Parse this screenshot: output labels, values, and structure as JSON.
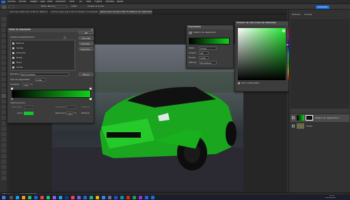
{
  "app": {
    "menu": [
      "Archivo",
      "Edición",
      "Imagen",
      "Capa",
      "Texto",
      "Selección",
      "Filtro",
      "3D",
      "Vista",
      "Plugins",
      "Ventana",
      "Ayuda"
    ],
    "share_button": "Compartir"
  },
  "options": {
    "mode_label": "Modo: Normal",
    "opacity": "100%",
    "snap_label": "Alinear al borde"
  },
  "tabs": [
    {
      "label": "auto-rojo-lambo.psd al 66,7% (Relleno de degradado 1, Máscara de capa/8)",
      "active": false
    },
    {
      "label": "camaro-negro.jpg al 66,7% (Relleno de degradado 1, Máscara de capa/8)",
      "active": false
    },
    {
      "label": "yellow-sport-car.psd al 66,7% (Relleno de degradado 1, Máscara de capa/8)",
      "active": true
    }
  ],
  "gradient_editor": {
    "title": "Editor de degradado",
    "presets_label": "Ajustes preestablecidos",
    "ok": "OK",
    "cancel": "Cancelar",
    "import": "Importar...",
    "export": "Exportar...",
    "folders": [
      "Básicos",
      "Verdes",
      "Púrpuras",
      "Rosas",
      "Rojos",
      "Grises"
    ],
    "name_label": "Nombre:",
    "name_value": "Personalizado",
    "new_button": "Nuevo",
    "type_label": "Tipo de degradado:",
    "type_value": "Sólido",
    "smooth_label": "Suavizar:",
    "smooth_value": "100",
    "smooth_unit": "%",
    "stops_label": "Interrupciones",
    "opacity_label": "Opacidad:",
    "location_label": "Ubicación:",
    "delete_label": "Eliminar",
    "color_label": "Color:",
    "color_location": "100",
    "color_unit": "%",
    "green": "#12c72a",
    "gradient_start": "#000000",
    "gradient_end": "#11d11a"
  },
  "properties": {
    "title": "Propiedades",
    "layer_label": "Relleno de degradado",
    "style_label": "Estilo:",
    "style_value": "Lineal",
    "angle_label": "Ángulo:",
    "angle_value": "90°",
    "scale_label": "Escala:",
    "scale_value": "100%",
    "method_label": "Método:",
    "method_value": "Perceptual"
  },
  "color_picker": {
    "title": "Selector de color (color de detención)",
    "ok": "OK",
    "cancel": "Cancelar",
    "add_to_swatches": "Añadir a muestras",
    "color_libraries": "Bibliotecas de colores",
    "web_only": "Solo colores Web",
    "new_label": "nuevo",
    "current_label": "actual",
    "hex": "11d11a",
    "fields": [
      {
        "label": "H:",
        "value": "123",
        "unit": "°"
      },
      {
        "label": "S:",
        "value": "92",
        "unit": "%"
      },
      {
        "label": "B:",
        "value": "82",
        "unit": "%"
      },
      {
        "label": "R:",
        "value": "17",
        "unit": ""
      },
      {
        "label": "G:",
        "value": "209",
        "unit": ""
      },
      {
        "label": "B:",
        "value": "26",
        "unit": ""
      }
    ],
    "lab": [
      {
        "label": "L:",
        "value": "72",
        "unit": ""
      },
      {
        "label": "a:",
        "value": "-71",
        "unit": ""
      },
      {
        "label": "b:",
        "value": "66",
        "unit": ""
      }
    ],
    "cmyk": [
      {
        "label": "C:",
        "value": "70",
        "unit": "%"
      },
      {
        "label": "M:",
        "value": "0",
        "unit": "%"
      },
      {
        "label": "Y:",
        "value": "100",
        "unit": "%"
      },
      {
        "label": "K:",
        "value": "0",
        "unit": "%"
      }
    ],
    "hue_color": "#21e52d"
  },
  "right_panel": {
    "tabs": [
      "Historial",
      "Colores"
    ],
    "layers": [
      {
        "name": "Relleno de degradado 1",
        "selected": true
      },
      {
        "name": "Fondo",
        "selected": false
      }
    ]
  },
  "status": {
    "zoom": "66,67%",
    "doc": "Doc: 2,64M/2,64M"
  },
  "taskbar": {
    "time": "21:06",
    "date": "12/08/2022"
  }
}
